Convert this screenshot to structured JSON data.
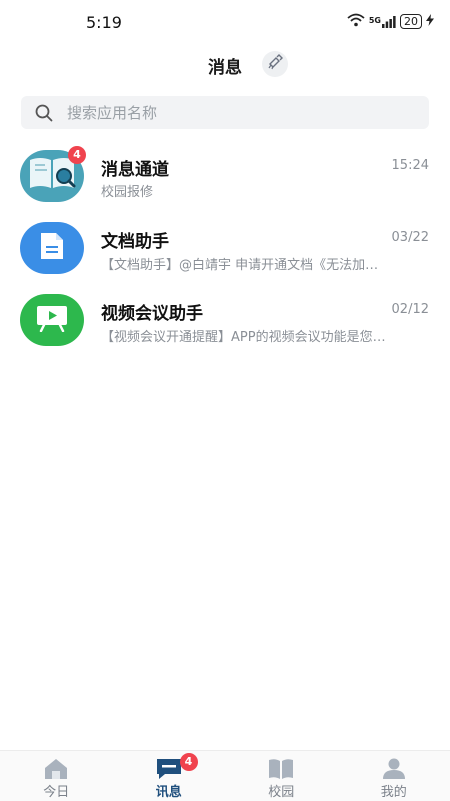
{
  "status_bar": {
    "time": "5:19",
    "network": "5G",
    "battery": "20"
  },
  "header": {
    "title": "消息"
  },
  "search": {
    "placeholder": "搜索应用名称"
  },
  "conversations": [
    {
      "title": "消息通道",
      "time": "15:24",
      "preview": "校园报修",
      "badge": "4",
      "icon": "book-search-icon"
    },
    {
      "title": "文档助手",
      "time": "03/22",
      "preview": "【文档助手】@白靖宇 申请开通文档《无法加…",
      "icon": "document-icon"
    },
    {
      "title": "视频会议助手",
      "time": "02/12",
      "preview": "【视频会议开通提醒】APP的视频会议功能是您…",
      "icon": "video-play-icon"
    }
  ],
  "tabbar": {
    "items": [
      {
        "label": "今日",
        "icon": "home-icon"
      },
      {
        "label": "讯息",
        "icon": "chat-icon",
        "badge": "4",
        "active": true
      },
      {
        "label": "校园",
        "icon": "book-icon"
      },
      {
        "label": "我的",
        "icon": "person-icon"
      }
    ]
  },
  "colors": {
    "accent": "#1f4f7d",
    "badge": "#f0434e",
    "doc_blue": "#3a8ee6",
    "video_green": "#2db84d",
    "book_teal": "#4aa3b8"
  }
}
